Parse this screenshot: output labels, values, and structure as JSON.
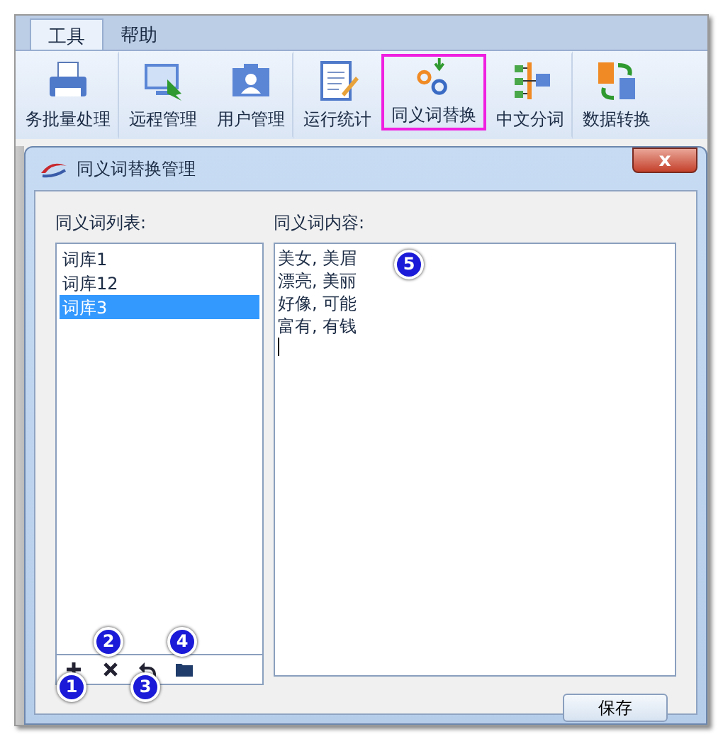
{
  "tabs": [
    {
      "label": "工具",
      "selected": true
    },
    {
      "label": "帮助",
      "selected": false
    }
  ],
  "toolbar": [
    {
      "label": "务批量处理",
      "highlighted": false,
      "group_end": true
    },
    {
      "label": "远程管理",
      "highlighted": false,
      "group_end": false
    },
    {
      "label": "用户管理",
      "highlighted": false,
      "group_end": true
    },
    {
      "label": "运行统计",
      "highlighted": false,
      "group_end": false
    },
    {
      "label": "同义词替换",
      "highlighted": true,
      "group_end": false
    },
    {
      "label": "中文分词",
      "highlighted": false,
      "group_end": true
    },
    {
      "label": "数据转换",
      "highlighted": false,
      "group_end": false
    }
  ],
  "dialog": {
    "title": "同义词替换管理",
    "close": "x",
    "list_label": "同义词列表:",
    "list_items": [
      {
        "label": "词库1",
        "selected": false
      },
      {
        "label": "词库12",
        "selected": false
      },
      {
        "label": "词库3",
        "selected": true
      }
    ],
    "list_tools": [
      {
        "kind": "add",
        "badge": "1"
      },
      {
        "kind": "delete",
        "badge": "2"
      },
      {
        "kind": "undo",
        "badge": "3"
      },
      {
        "kind": "folder",
        "badge": "4"
      }
    ],
    "content_label": "同义词内容:",
    "content_lines": [
      "美女, 美眉",
      "漂亮, 美丽",
      "好像, 可能",
      "富有, 有钱"
    ],
    "content_badge": "5",
    "save_button": "保存"
  }
}
